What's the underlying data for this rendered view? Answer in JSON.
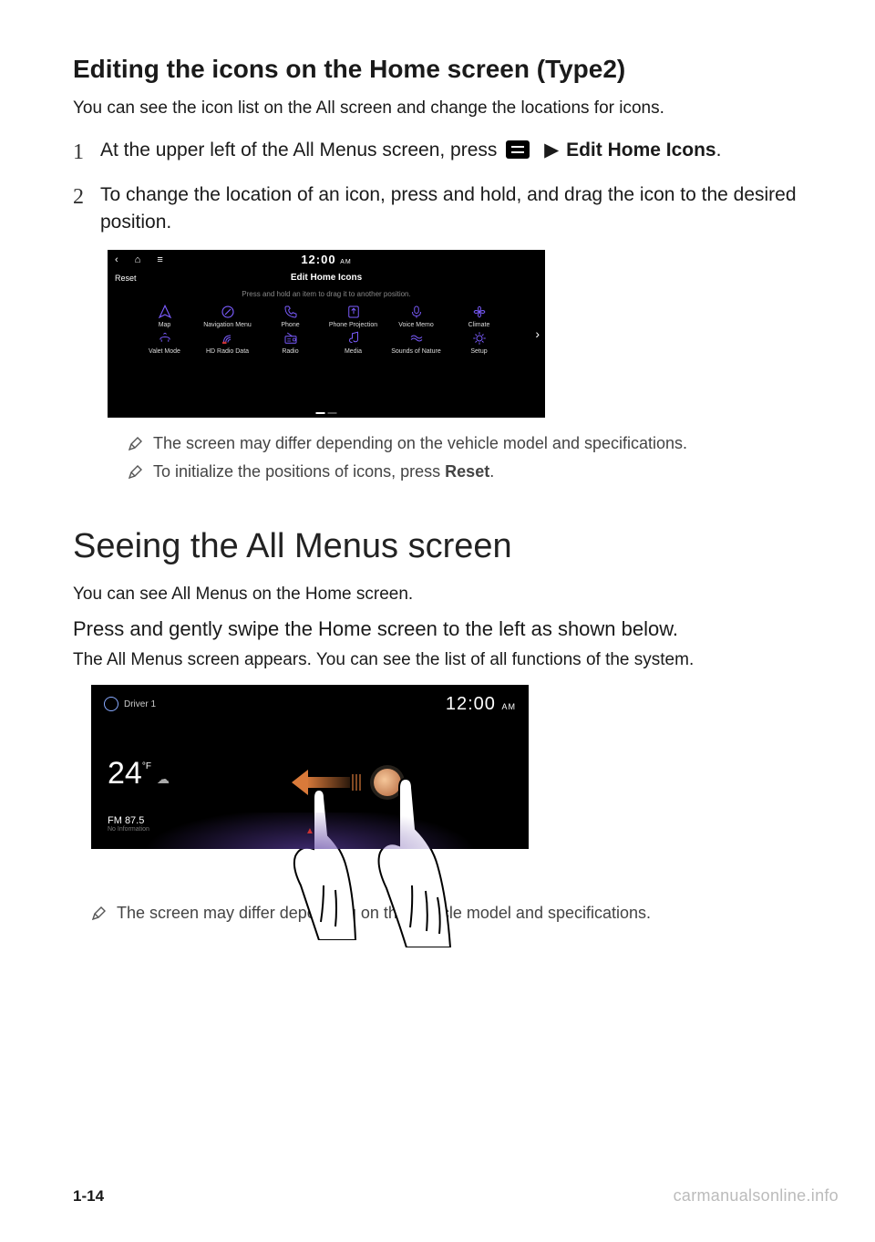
{
  "section1": {
    "title": "Editing the icons on the Home screen (Type2)",
    "intro": "You can see the icon list on the All screen and change the locations for icons.",
    "step1_pre": "At the upper left of the All Menus screen, press ",
    "step1_post": " Edit Home Icons",
    "step1_period": ".",
    "step2": "To change the location of an icon, press and hold, and drag the icon to the desired position.",
    "caret": "▶",
    "device": {
      "back": "‹",
      "home": "⌂",
      "menu": "≡",
      "time": "12:00",
      "ampm": "AM",
      "reset": "Reset",
      "title": "Edit Home Icons",
      "hint": "Press and hold an item to drag it to another position.",
      "arrow": "›",
      "row1": [
        "Map",
        "Navigation Menu",
        "Phone",
        "Phone Projection",
        "Voice Memo",
        "Climate"
      ],
      "row2": [
        "Valet Mode",
        "HD Radio Data",
        "Radio",
        "Media",
        "Sounds of Nature",
        "Setup"
      ]
    },
    "note1": "The screen may differ depending on the vehicle model and specifications.",
    "note2_pre": "To initialize the positions of icons, press ",
    "note2_bold": "Reset",
    "note2_post": "."
  },
  "section2": {
    "title": "Seeing the All Menus screen",
    "intro": "You can see All Menus on the Home screen.",
    "instruction": "Press and gently swipe the Home screen to the left as shown below.",
    "sub": "The All Menus screen appears. You can see the list of all functions of the system.",
    "device": {
      "driver": "Driver 1",
      "time": "12:00",
      "ampm": "AM",
      "temp": "24",
      "unit": "°F",
      "weather": "☁",
      "station": "FM 87.5",
      "station_sub": "No Information",
      "caret_up": "▲"
    },
    "note": "The screen may differ depending on the vehicle model and specifications."
  },
  "page_num": "1-14",
  "watermark": "carmanualsonline.info"
}
